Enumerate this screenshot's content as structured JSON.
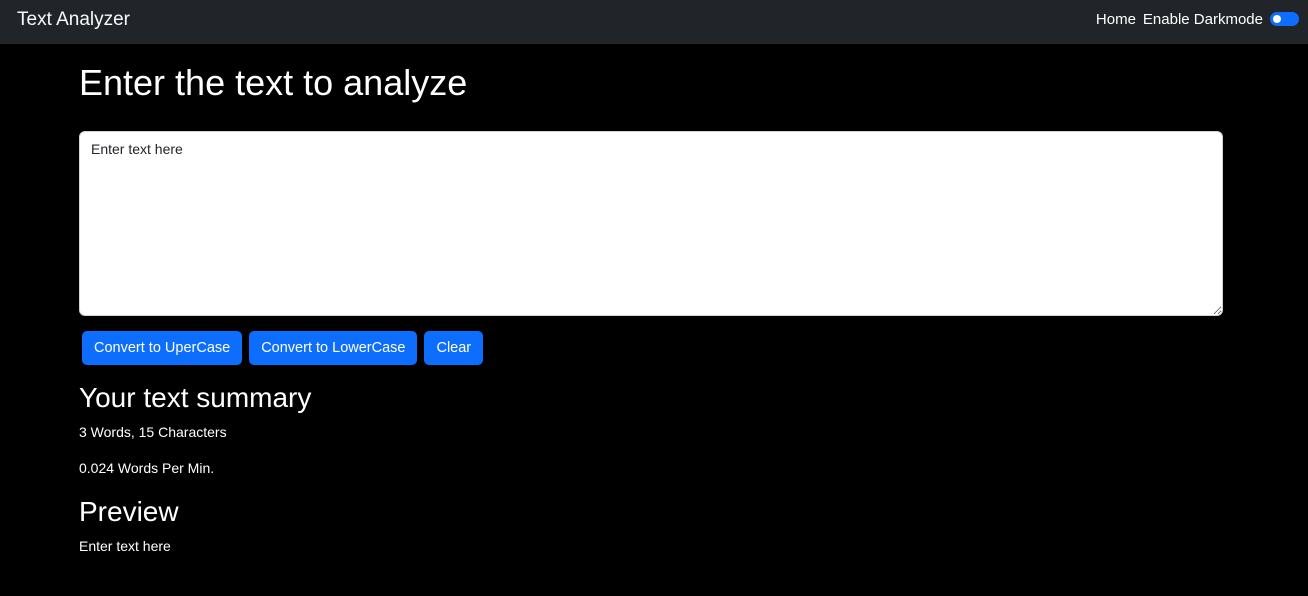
{
  "navbar": {
    "brand": "Text Analyzer",
    "home_link": "Home",
    "darkmode_label": "Enable Darkmode",
    "darkmode_enabled": true
  },
  "main": {
    "heading": "Enter the text to analyze",
    "textarea": {
      "placeholder": "Enter text here",
      "value": ""
    },
    "buttons": {
      "uppercase": "Convert to UperCase",
      "lowercase": "Convert to LowerCase",
      "clear": "Clear"
    },
    "summary": {
      "heading": "Your text summary",
      "counts": "3 Words, 15 Characters",
      "reading_time": "0.024 Words Per Min."
    },
    "preview": {
      "heading": "Preview",
      "text": "Enter text here"
    }
  },
  "colors": {
    "navbar_bg": "#212529",
    "page_bg": "#000000",
    "button_bg": "#0d6efd",
    "switch_on": "#0d6efd"
  }
}
